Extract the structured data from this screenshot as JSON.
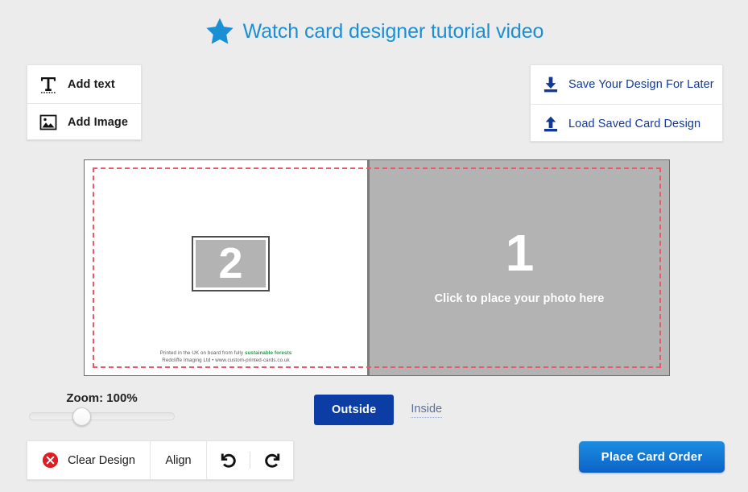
{
  "header": {
    "tutorial_label": "Watch card designer tutorial video",
    "star_icon": "star-icon",
    "accent_color": "#1b8fd4"
  },
  "left_tools": {
    "items": [
      {
        "label": "Add text",
        "icon": "text-t-icon"
      },
      {
        "label": "Add Image",
        "icon": "image-picture-icon"
      }
    ]
  },
  "save_load": {
    "items": [
      {
        "label": "Save Your Design For Later",
        "icon": "download-icon"
      },
      {
        "label": "Load Saved Card Design",
        "icon": "upload-icon"
      }
    ],
    "link_color": "#123a94"
  },
  "canvas": {
    "left_panel": {
      "photo_placeholder_number": "2",
      "smallprint_line1_prefix": "Printed in the UK on board from fully ",
      "smallprint_line1_highlight": "sustainable forests",
      "smallprint_line2": "Redcliffe Imaging Ltd • www.custom-printed-cards.co.uk",
      "highlight_color": "#1e9e4a"
    },
    "right_panel": {
      "photo_placeholder_number": "1",
      "drop_text": "Click to place your photo here"
    },
    "bleed_guide_color": "#e8596a"
  },
  "zoom": {
    "label": "Zoom: 100%",
    "value": 100,
    "handle_position_percent": 33
  },
  "side_tabs": {
    "outside_label": "Outside",
    "inside_label": "Inside",
    "active": "Outside",
    "active_color": "#0b3da4"
  },
  "bottom_toolbar": {
    "clear_design_label": "Clear Design",
    "clear_icon": "error-circle-x-icon",
    "align_label": "Align",
    "undo_icon": "undo-arrow-icon",
    "redo_icon": "redo-arrow-icon"
  },
  "order": {
    "place_card_order_label": "Place Card Order",
    "button_color": "#1b8ee0"
  }
}
